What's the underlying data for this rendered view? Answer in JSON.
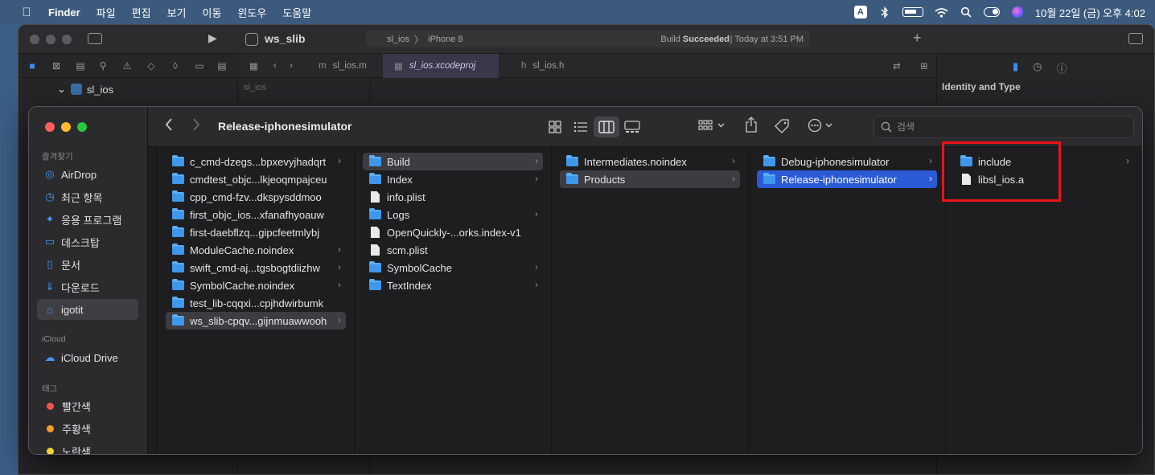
{
  "menubar": {
    "app_name": "Finder",
    "menus": [
      "파일",
      "편집",
      "보기",
      "이동",
      "윈도우",
      "도움말"
    ],
    "input_source": "A",
    "clock": "10월 22일 (금) 오후 4:02"
  },
  "xcode": {
    "project_title": "ws_slib",
    "status": {
      "scheme": "sl_ios",
      "device": "iPhone 8",
      "build_prefix": "Build ",
      "build_result": "Succeeded",
      "build_time": "| Today at 3:51 PM"
    },
    "tabs": [
      {
        "icon": "m",
        "label": "sl_ios.m"
      },
      {
        "icon": "▦",
        "label": "sl_ios.xcodeproj"
      },
      {
        "icon": "h",
        "label": "sl_ios.h"
      }
    ],
    "navigator_project": "sl_ios",
    "editor_crumb": "sl_ios",
    "inspector_title": "Identity and Type"
  },
  "finder": {
    "title": "Release-iphonesimulator",
    "search": {
      "placeholder": "검색"
    },
    "sidebar": {
      "favorites_header": "즐겨찾기",
      "favorites": [
        {
          "icon": "airdrop-icon",
          "label": "AirDrop"
        },
        {
          "icon": "clock-icon",
          "label": "최근 항목"
        },
        {
          "icon": "applications-icon",
          "label": "응용 프로그램"
        },
        {
          "icon": "desktop-icon",
          "label": "데스크탑"
        },
        {
          "icon": "document-icon",
          "label": "문서"
        },
        {
          "icon": "download-icon",
          "label": "다운로드"
        },
        {
          "icon": "home-icon",
          "label": "igotit"
        }
      ],
      "icloud_header": "iCloud",
      "icloud": [
        {
          "icon": "cloud-icon",
          "label": "iCloud Drive"
        }
      ],
      "tags_header": "태그",
      "tags": [
        {
          "label": "빨간색",
          "color": "#f0514b"
        },
        {
          "label": "주황색",
          "color": "#f59d2a"
        },
        {
          "label": "노란색",
          "color": "#f2d52c"
        }
      ]
    },
    "columns": [
      {
        "items": [
          {
            "name": "c_cmd-dzegs...bpxevyjhadqrt",
            "type": "folder",
            "chevron": true
          },
          {
            "name": "cmdtest_objc...lkjeoqmpajceu",
            "type": "folder",
            "chevron": false
          },
          {
            "name": "cpp_cmd-fzv...dkspysddmoo",
            "type": "folder",
            "chevron": false
          },
          {
            "name": "first_objc_ios...xfanafhyoauw",
            "type": "folder",
            "chevron": false
          },
          {
            "name": "first-daebflzq...gipcfeetmlybj",
            "type": "folder",
            "chevron": false
          },
          {
            "name": "ModuleCache.noindex",
            "type": "folder",
            "chevron": true
          },
          {
            "name": "swift_cmd-aj...tgsbogtdiizhw",
            "type": "folder",
            "chevron": true
          },
          {
            "name": "SymbolCache.noindex",
            "type": "folder",
            "chevron": true
          },
          {
            "name": "test_lib-cqqxi...cpjhdwirbumk",
            "type": "folder",
            "chevron": false
          },
          {
            "name": "ws_slib-cpqv...gijnmuawwooh",
            "type": "folder",
            "chevron": true,
            "selected": "grey"
          }
        ]
      },
      {
        "items": [
          {
            "name": "Build",
            "type": "folder",
            "chevron": true,
            "selected": "grey"
          },
          {
            "name": "Index",
            "type": "folder",
            "chevron": true
          },
          {
            "name": "info.plist",
            "type": "file",
            "chevron": false
          },
          {
            "name": "Logs",
            "type": "folder",
            "chevron": true
          },
          {
            "name": "OpenQuickly-...orks.index-v1",
            "type": "file",
            "chevron": false
          },
          {
            "name": "scm.plist",
            "type": "file",
            "chevron": false
          },
          {
            "name": "SymbolCache",
            "type": "folder",
            "chevron": true
          },
          {
            "name": "TextIndex",
            "type": "folder",
            "chevron": true
          }
        ]
      },
      {
        "items": [
          {
            "name": "Intermediates.noindex",
            "type": "folder",
            "chevron": true
          },
          {
            "name": "Products",
            "type": "folder",
            "chevron": true,
            "selected": "grey"
          }
        ]
      },
      {
        "items": [
          {
            "name": "Debug-iphonesimulator",
            "type": "folder",
            "chevron": true
          },
          {
            "name": "Release-iphonesimulator",
            "type": "folder",
            "chevron": true,
            "selected": "blue"
          }
        ]
      },
      {
        "items": [
          {
            "name": "include",
            "type": "folder",
            "chevron": true
          },
          {
            "name": "libsl_ios.a",
            "type": "file",
            "chevron": false
          }
        ]
      }
    ],
    "annotation_color": "#e8141a"
  }
}
